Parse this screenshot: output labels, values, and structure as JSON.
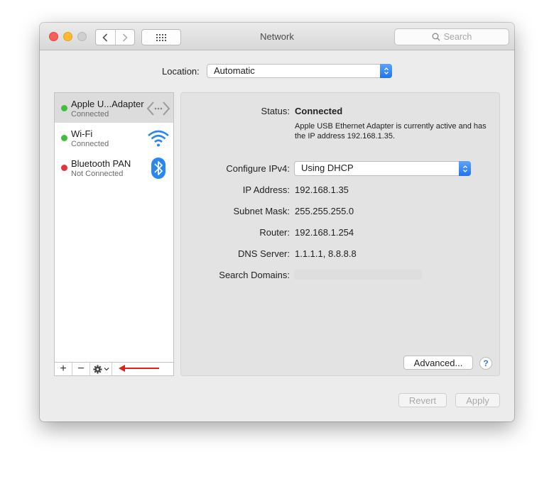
{
  "window": {
    "title": "Network",
    "search_placeholder": "Search"
  },
  "location": {
    "label": "Location:",
    "value": "Automatic"
  },
  "services": [
    {
      "name": "Apple U...Adapter",
      "status": "Connected",
      "status_color": "#3fbf3a",
      "icon": "ethernet-icon",
      "selected": true
    },
    {
      "name": "Wi-Fi",
      "status": "Connected",
      "status_color": "#3fbf3a",
      "icon": "wifi-icon",
      "selected": false
    },
    {
      "name": "Bluetooth PAN",
      "status": "Not Connected",
      "status_color": "#e0393b",
      "icon": "bluetooth-icon",
      "selected": false
    }
  ],
  "toolbar": {
    "add_label": "+",
    "remove_label": "−"
  },
  "detail": {
    "status_label": "Status:",
    "status_value": "Connected",
    "status_description": "Apple USB Ethernet Adapter is currently active and has the IP address 192.168.1.35.",
    "configure_label": "Configure IPv4:",
    "configure_value": "Using DHCP",
    "ip_label": "IP Address:",
    "ip_value": "192.168.1.35",
    "subnet_label": "Subnet Mask:",
    "subnet_value": "255.255.255.0",
    "router_label": "Router:",
    "router_value": "192.168.1.254",
    "dns_label": "DNS Server:",
    "dns_value": "1.1.1.1, 8.8.8.8",
    "search_domains_label": "Search Domains:",
    "advanced_label": "Advanced...",
    "help_label": "?"
  },
  "footer": {
    "revert_label": "Revert",
    "apply_label": "Apply"
  },
  "colors": {
    "accent": "#2b7cf0",
    "annotation_arrow": "#e0201b"
  }
}
